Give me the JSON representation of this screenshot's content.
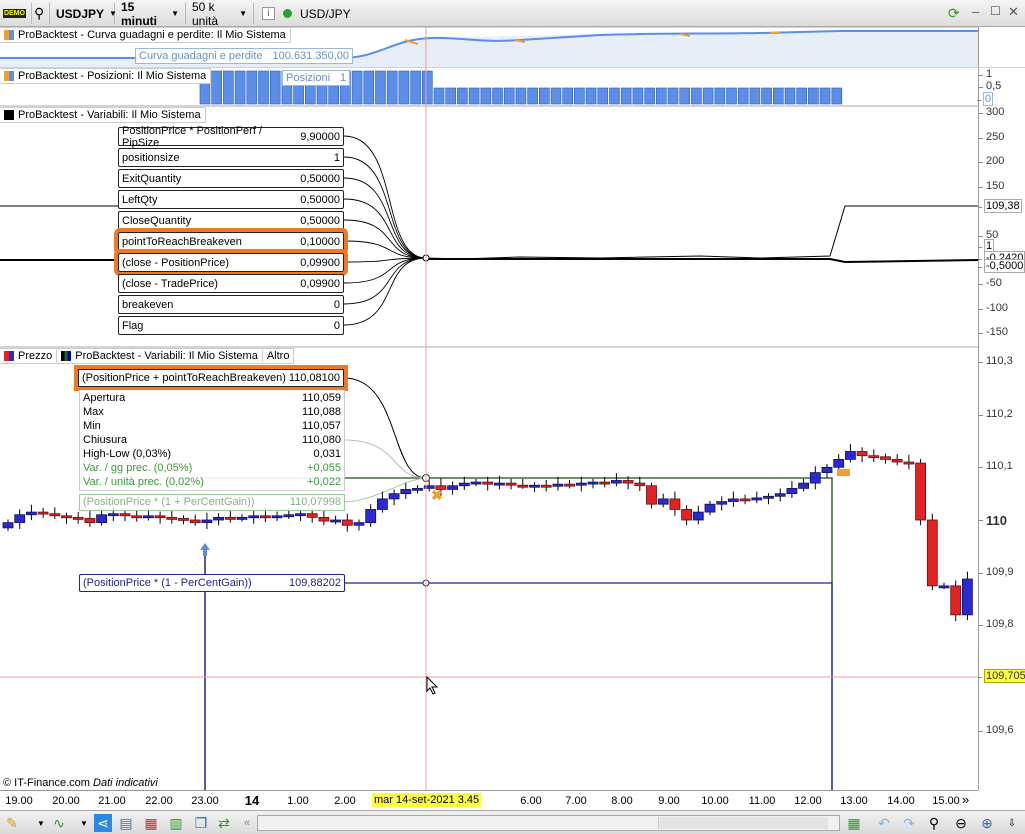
{
  "toolbar": {
    "demo_label": "DEMO",
    "symbol": "USDJPY",
    "timeframe": "15 minuti",
    "units": "50 k unità",
    "instrument": "USD/JPY",
    "info_icon": "i"
  },
  "panels": {
    "equity": {
      "title": "ProBacktest - Curva guadagni e perdite: Il Mio Sistema",
      "tooltip_label": "Curva guadagni e perdite",
      "tooltip_value": "100.631.350,00"
    },
    "positions": {
      "title": "ProBacktest - Posizioni: Il Mio Sistema",
      "tooltip_label": "Posizioni",
      "tooltip_value": "1",
      "axis": [
        "1",
        "0,5",
        "0"
      ]
    },
    "variables": {
      "title": "ProBacktest - Variabili: Il Mio Sistema",
      "items": [
        {
          "label": "PositionPrice * PositionPerf / PipSize",
          "value": "9,90000"
        },
        {
          "label": "positionsize",
          "value": "1"
        },
        {
          "label": "ExitQuantity",
          "value": "0,50000"
        },
        {
          "label": "LeftQty",
          "value": "0,50000"
        },
        {
          "label": "CloseQuantity",
          "value": "0,50000"
        },
        {
          "label": "pointToReachBreakeven",
          "value": "0,10000"
        },
        {
          "label": "(close - PositionPrice)",
          "value": "0,09900"
        },
        {
          "label": "(close - TradePrice)",
          "value": "0,09900"
        },
        {
          "label": "breakeven",
          "value": "0"
        },
        {
          "label": "Flag",
          "value": "0"
        }
      ],
      "axis": [
        "300",
        "250",
        "200",
        "150",
        "50",
        "-50",
        "-100",
        "-150"
      ],
      "axis_tags": [
        "109,38",
        "1",
        "-0,2420",
        "-0,5000"
      ]
    },
    "price": {
      "tabs": [
        "Prezzo",
        "ProBacktest - Variabili: Il Mio Sistema",
        "Altro"
      ],
      "highlight": {
        "label": "(PositionPrice + pointToReachBreakeven)",
        "value": "110,08100"
      },
      "ohlc": [
        {
          "label": "Apertura",
          "value": "110,059"
        },
        {
          "label": "Max",
          "value": "110,088"
        },
        {
          "label": "Min",
          "value": "110,057"
        },
        {
          "label": "Chiusura",
          "value": "110,080"
        },
        {
          "label": "High-Low (0,03%)",
          "value": "0,031"
        },
        {
          "label": "Var. / gg prec. (0,05%)",
          "value": "+0,055"
        },
        {
          "label": "Var. / unità prec. (0,02%)",
          "value": "+0,022"
        }
      ],
      "gain": {
        "label": "(PositionPrice * (1 + PerCentGain))",
        "value": "110,07998"
      },
      "loss": {
        "label": "(PositionPrice * (1 - PerCentGain))",
        "value": "109,88202"
      },
      "axis": [
        "110,3",
        "110,2",
        "110,1",
        "110",
        "109,9",
        "109,8",
        "109,6"
      ],
      "cursor_price": "109,705",
      "copyright": "© IT-Finance.com",
      "disclaimer": "Dati indicativi"
    }
  },
  "xaxis": {
    "labels": [
      "19.00",
      "20.00",
      "21.00",
      "22.00",
      "23.00",
      "14",
      "1.00",
      "2.00",
      "6.00",
      "7.00",
      "8.00",
      "9.00",
      "10.00",
      "11.00",
      "12.00",
      "13.00",
      "14.00",
      "15.00"
    ],
    "cursor_date": "mar 14-set-2021 3.45",
    "more": "»"
  },
  "colors": {
    "up": "#2a2ad0",
    "down": "#e32222",
    "highlight": "#f07820",
    "cursor": "#ffff40"
  },
  "chart_data": {
    "type": "candlestick",
    "symbol": "USDJPY",
    "ylim": [
      109.55,
      110.35
    ],
    "closes": [
      109.995,
      110.01,
      110.015,
      110.012,
      110.008,
      110.005,
      110.003,
      109.995,
      110.01,
      110.012,
      110.008,
      110.005,
      110.008,
      110.005,
      110.003,
      110.0,
      109.995,
      110.0,
      110.005,
      110.003,
      110.005,
      110.008,
      110.006,
      110.008,
      110.01,
      110.012,
      110.005,
      109.998,
      110.0,
      109.99,
      109.995,
      110.02,
      110.04,
      110.05,
      110.058,
      110.06,
      110.065,
      110.058,
      110.065,
      110.07,
      110.072,
      110.068,
      110.07,
      110.066,
      110.065,
      110.066,
      110.064,
      110.068,
      110.066,
      110.07,
      110.072,
      110.07,
      110.075,
      110.07,
      110.065,
      110.03,
      110.04,
      110.02,
      110.0,
      110.015,
      110.03,
      110.035,
      110.04,
      110.038,
      110.042,
      110.045,
      110.05,
      110.06,
      110.07,
      110.09,
      110.1,
      110.115,
      110.13,
      110.122,
      110.12,
      110.115,
      110.11,
      110.108,
      110.0,
      109.875,
      109.875,
      109.82,
      109.888
    ],
    "first_open": 109.985
  }
}
